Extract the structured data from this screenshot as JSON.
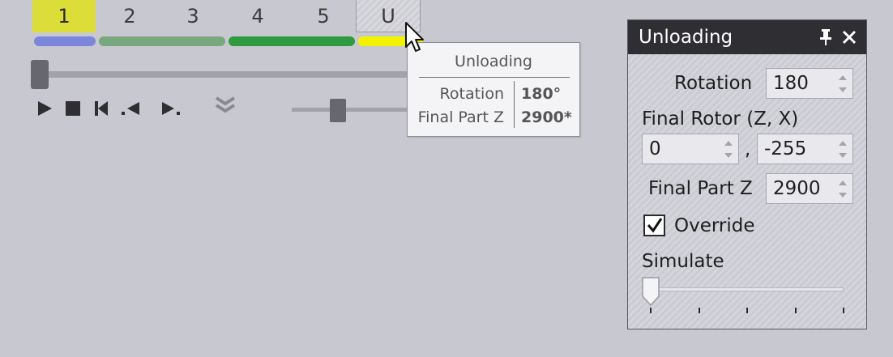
{
  "steps": {
    "tabs": [
      {
        "label": "1",
        "active": true,
        "bar_color": "#7d86dd"
      },
      {
        "label": "2",
        "active": false,
        "bar_color": "#79a87e"
      },
      {
        "label": "3",
        "active": false,
        "bar_color": "#79a87e"
      },
      {
        "label": "4",
        "active": false,
        "bar_color": "#2f9a3f"
      },
      {
        "label": "5",
        "active": false,
        "bar_color": "#2f9a3f"
      },
      {
        "label": "U",
        "active": false,
        "bar_color": "#f2f200"
      }
    ]
  },
  "timeline": {
    "position_fraction": 0.0
  },
  "transport": {
    "icons": [
      "play-icon",
      "stop-icon",
      "skip-to-start-icon",
      "step-back-icon",
      "step-forward-icon",
      "collapse-chevrons-icon"
    ],
    "speed_fraction": 0.35
  },
  "tooltip": {
    "title": "Unloading",
    "rows": [
      {
        "label": "Rotation",
        "value": "180°"
      },
      {
        "label": "Final Part Z",
        "value": "2900*"
      }
    ]
  },
  "panel": {
    "title": "Unloading",
    "rotation": {
      "label": "Rotation",
      "value": "180"
    },
    "final_rotor": {
      "label": "Final Rotor (Z, X)",
      "z_value": "0",
      "separator": ",",
      "x_value": "-255"
    },
    "final_part_z": {
      "label": "Final Part Z",
      "value": "2900"
    },
    "override": {
      "label": "Override",
      "checked": true
    },
    "simulate": {
      "label": "Simulate",
      "value_fraction": 0.0,
      "tick_count": 5
    }
  },
  "colors": {
    "accent_yellow": "#dddd3a",
    "panel_header": "#2e2e33",
    "background": "#c8c8d0"
  }
}
